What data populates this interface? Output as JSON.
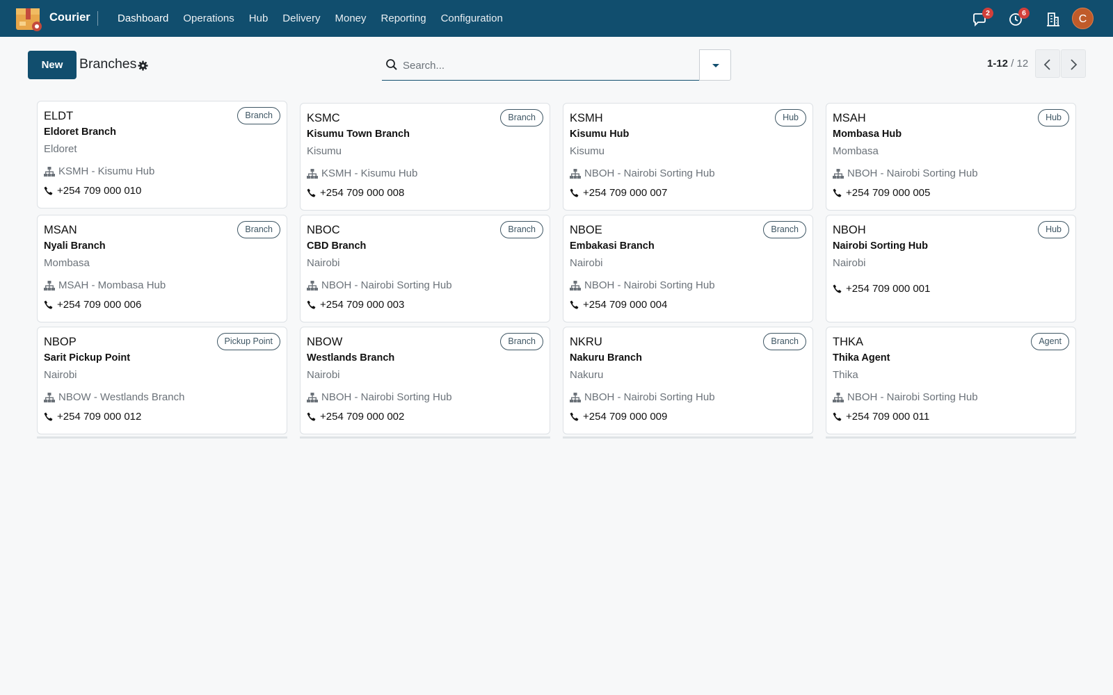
{
  "app": {
    "name": "Courier",
    "menu": [
      "Dashboard",
      "Operations",
      "Hub",
      "Delivery",
      "Money",
      "Reporting",
      "Configuration"
    ],
    "systray": {
      "messages_count": "2",
      "activities_count": "6",
      "user_initial": "C"
    }
  },
  "control_panel": {
    "new_label": "New",
    "title": "Branches",
    "search_placeholder": "Search...",
    "pager_range": "1-12",
    "pager_sep": " / ",
    "pager_total": "12"
  },
  "cards": [
    {
      "code": "ELDT",
      "type": "Branch",
      "name": "Eldoret Branch",
      "city": "Eldoret",
      "parent": "KSMH - Kisumu Hub",
      "phone": "+254 709 000 010"
    },
    {
      "code": "KSMC",
      "type": "Branch",
      "name": "Kisumu Town Branch",
      "city": "Kisumu",
      "parent": "KSMH - Kisumu Hub",
      "phone": "+254 709 000 008"
    },
    {
      "code": "KSMH",
      "type": "Hub",
      "name": "Kisumu Hub",
      "city": "Kisumu",
      "parent": "NBOH - Nairobi Sorting Hub",
      "phone": "+254 709 000 007"
    },
    {
      "code": "MSAH",
      "type": "Hub",
      "name": "Mombasa Hub",
      "city": "Mombasa",
      "parent": "NBOH - Nairobi Sorting Hub",
      "phone": "+254 709 000 005"
    },
    {
      "code": "MSAN",
      "type": "Branch",
      "name": "Nyali Branch",
      "city": "Mombasa",
      "parent": "MSAH - Mombasa Hub",
      "phone": "+254 709 000 006"
    },
    {
      "code": "NBOC",
      "type": "Branch",
      "name": "CBD Branch",
      "city": "Nairobi",
      "parent": "NBOH - Nairobi Sorting Hub",
      "phone": "+254 709 000 003"
    },
    {
      "code": "NBOE",
      "type": "Branch",
      "name": "Embakasi Branch",
      "city": "Nairobi",
      "parent": "NBOH - Nairobi Sorting Hub",
      "phone": "+254 709 000 004"
    },
    {
      "code": "NBOH",
      "type": "Hub",
      "name": "Nairobi Sorting Hub",
      "city": "Nairobi",
      "parent": "",
      "phone": "+254 709 000 001"
    },
    {
      "code": "NBOP",
      "type": "Pickup Point",
      "name": "Sarit Pickup Point",
      "city": "Nairobi",
      "parent": "NBOW - Westlands Branch",
      "phone": "+254 709 000 012"
    },
    {
      "code": "NBOW",
      "type": "Branch",
      "name": "Westlands Branch",
      "city": "Nairobi",
      "parent": "NBOH - Nairobi Sorting Hub",
      "phone": "+254 709 000 002"
    },
    {
      "code": "NKRU",
      "type": "Branch",
      "name": "Nakuru Branch",
      "city": "Nakuru",
      "parent": "NBOH - Nairobi Sorting Hub",
      "phone": "+254 709 000 009"
    },
    {
      "code": "THKA",
      "type": "Agent",
      "name": "Thika Agent",
      "city": "Thika",
      "parent": "NBOH - Nairobi Sorting Hub",
      "phone": "+254 709 000 011"
    }
  ],
  "icons": {
    "app_logo": "box-package-icon",
    "messages": "chat-bubble-icon",
    "activities": "clock-icon",
    "company": "building-icon",
    "settings": "gear-icon",
    "search": "search-icon",
    "parent": "sitemap-icon",
    "phone": "phone-icon"
  },
  "colors": {
    "navbar": "#114e6e",
    "primary": "#114e6e",
    "badge": "#d23f3a",
    "avatar": "#c05b2a"
  }
}
